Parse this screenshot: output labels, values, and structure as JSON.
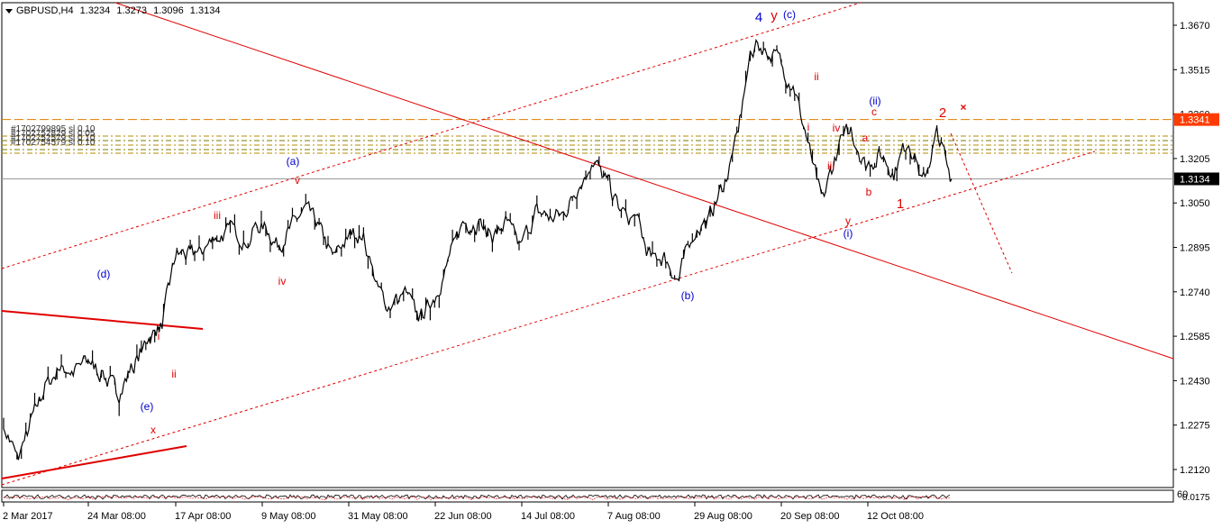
{
  "header": {
    "symbol": "GBPUSD,H4",
    "open": "1.3234",
    "high": "1.3273",
    "low": "1.3096",
    "close": "1.3134"
  },
  "order_labels": [
    "#1702799895 sl 0.10",
    "#1702752829 sl 0.05",
    "#1702752579 sl 0.10",
    "#1702754579 sl 0.10"
  ],
  "price_axis": {
    "ticks": [
      "1.3670",
      "1.3515",
      "1.3360",
      "1.3205",
      "1.3050",
      "1.2895",
      "1.2740",
      "1.2585",
      "1.2430",
      "1.2275",
      "1.2120"
    ],
    "current_price": "1.3134",
    "level_price": "1.3341",
    "indicator_ticks": [
      "60",
      "0.0175"
    ]
  },
  "time_axis": [
    "2 Mar 2017",
    "24 Mar 08:00",
    "17 Apr 08:00",
    "9 May 08:00",
    "31 May 08:00",
    "22 Jun 08:00",
    "14 Jul 08:00",
    "7 Aug 08:00",
    "29 Aug 08:00",
    "20 Sep 08:00",
    "12 Oct 08:00"
  ],
  "wave_labels": [
    {
      "text": "(d)",
      "color": "#0000cc"
    },
    {
      "text": "(e)",
      "color": "#0000cc"
    },
    {
      "text": "x",
      "color": "#e00000"
    },
    {
      "text": "i",
      "color": "#e00000"
    },
    {
      "text": "ii",
      "color": "#e00000"
    },
    {
      "text": "iii",
      "color": "#e00000"
    },
    {
      "text": "iv",
      "color": "#e00000"
    },
    {
      "text": "v",
      "color": "#e00000"
    },
    {
      "text": "(a)",
      "color": "#0000cc"
    },
    {
      "text": "(b)",
      "color": "#0000cc"
    },
    {
      "text": "4",
      "color": "#0000cc"
    },
    {
      "text": "y",
      "color": "#e00000"
    },
    {
      "text": "(c)",
      "color": "#0000cc"
    },
    {
      "text": "ii",
      "color": "#e00000"
    },
    {
      "text": "i",
      "color": "#e00000"
    },
    {
      "text": "iv",
      "color": "#e00000"
    },
    {
      "text": "iii",
      "color": "#e00000"
    },
    {
      "text": "y",
      "color": "#e00000"
    },
    {
      "text": "(i)",
      "color": "#0000cc"
    },
    {
      "text": "(ii)",
      "color": "#0000cc"
    },
    {
      "text": "c",
      "color": "#e00000"
    },
    {
      "text": "a",
      "color": "#e00000"
    },
    {
      "text": "b",
      "color": "#e00000"
    },
    {
      "text": "1",
      "color": "#e00000"
    },
    {
      "text": "2",
      "color": "#e00000"
    },
    {
      "text": "×",
      "color": "#e00000"
    }
  ],
  "colors": {
    "price_line": "#000000",
    "trend": "#e00000",
    "wave_blue": "#0000cc",
    "level_line": "#e07b00",
    "level_label_bg": "#ff3b00",
    "current_label_bg": "#000000"
  },
  "chart_data": {
    "type": "line",
    "title": "GBPUSD,H4",
    "ylim": [
      1.205,
      1.378
    ],
    "x": [
      "2 Mar 2017",
      "24 Mar 08:00",
      "17 Apr 08:00",
      "9 May 08:00",
      "31 May 08:00",
      "22 Jun 08:00",
      "14 Jul 08:00",
      "7 Aug 08:00",
      "29 Aug 08:00",
      "20 Sep 08:00",
      "12 Oct 08:00"
    ],
    "series": [
      {
        "values": [
          1.229,
          1.214,
          1.23,
          1.242,
          1.248,
          1.246,
          1.25,
          1.245,
          1.238,
          1.248,
          1.258,
          1.262,
          1.287,
          1.286,
          1.289,
          1.294,
          1.295,
          1.293,
          1.298,
          1.29,
          1.296,
          1.303,
          1.295,
          1.285,
          1.293,
          1.295,
          1.274,
          1.269,
          1.272,
          1.264,
          1.272,
          1.285,
          1.298,
          1.298,
          1.293,
          1.298,
          1.288,
          1.302,
          1.3,
          1.301,
          1.311,
          1.321,
          1.312,
          1.301,
          1.299,
          1.286,
          1.286,
          1.278,
          1.296,
          1.298,
          1.31,
          1.325,
          1.358,
          1.36,
          1.354,
          1.346,
          1.326,
          1.305,
          1.323,
          1.331,
          1.318,
          1.322,
          1.316,
          1.327,
          1.312,
          1.329,
          1.3134
        ]
      }
    ]
  }
}
